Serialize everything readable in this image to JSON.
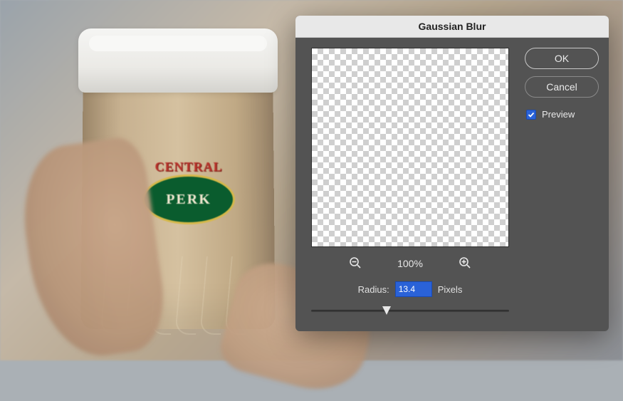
{
  "dialog": {
    "title": "Gaussian Blur",
    "ok_label": "OK",
    "cancel_label": "Cancel",
    "preview_label": "Preview",
    "preview_checked": true,
    "zoom_level": "100%",
    "radius_label": "Radius:",
    "radius_value": "13.4",
    "radius_units": "Pixels",
    "slider_percent": 38
  },
  "logo": {
    "top": "CENTRAL",
    "bottom": "PERK"
  }
}
